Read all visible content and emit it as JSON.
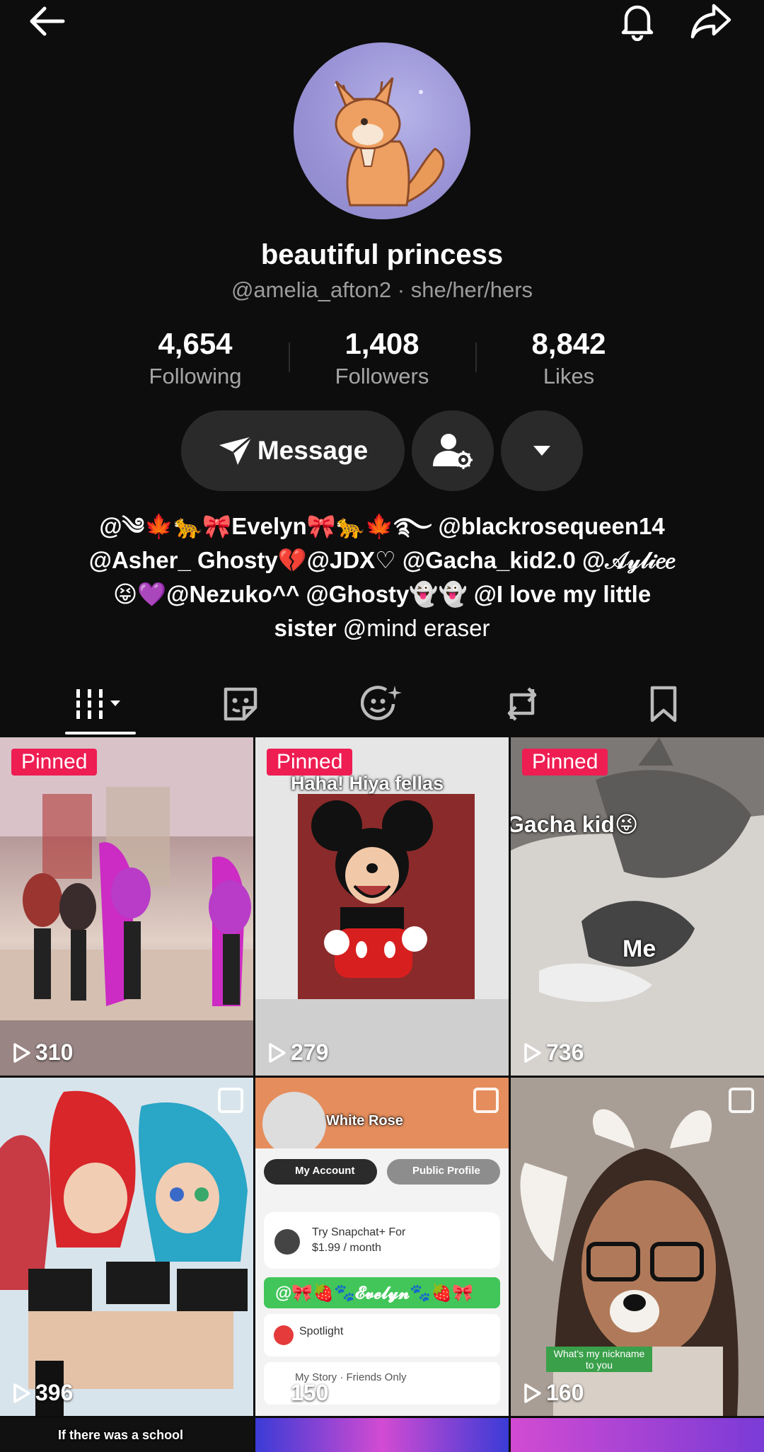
{
  "profile": {
    "display_name": "beautiful princess",
    "handle_line": "@amelia_afton2 · she/her/hers"
  },
  "stats": {
    "following": {
      "value": "4,654",
      "label": "Following"
    },
    "followers": {
      "value": "1,408",
      "label": "Followers"
    },
    "likes": {
      "value": "8,842",
      "label": "Likes"
    }
  },
  "actions": {
    "message_label": "Message"
  },
  "bio": {
    "line1": "@༄🍁🐆🎀Evelyn🎀🐆🍁࿐ @blackrosequeen14",
    "line2": "@Asher_ Ghosty💔@JDX♡ @Gacha_kid2.0 @𝒜𝓎𝓁𝒾𝑒𝑒",
    "line3": "😝💜@Nezuko^^ @Ghosty👻👻 @I love my little",
    "line4_bold": "sister",
    "line4_rest": " @mind eraser"
  },
  "tabs": [
    "videos",
    "favorites",
    "liked",
    "reposts",
    "saved"
  ],
  "grid": {
    "pinned_label": "Pinned",
    "items": [
      {
        "views": "310",
        "pinned": true
      },
      {
        "views": "279",
        "pinned": true,
        "caption": "Haha! Hiya fellas"
      },
      {
        "views": "736",
        "pinned": true,
        "caption": "Gacha kid😜",
        "caption2": "Me"
      },
      {
        "views": "396"
      },
      {
        "views": "150",
        "card_title": "White Rose",
        "tab1": "My Account",
        "tab2": "Public Profile",
        "promo_title": "Try Snapchat+ For",
        "promo_price": "$1.99 / month",
        "banner": "@🎀🍓🐾𝓔𝓿𝓮𝓵𝔂𝓷🐾🍓🎀",
        "spotlight": "Spotlight",
        "story": "My Story · Friends Only"
      },
      {
        "views": "160",
        "caption": "What's my nickname to you"
      },
      {
        "caption": "If there was a school"
      }
    ]
  },
  "colors": {
    "background": "#0d0d0d",
    "button": "#2a2a2a",
    "pinned": "#ee1d52",
    "muted_text": "#a6a6a6"
  }
}
